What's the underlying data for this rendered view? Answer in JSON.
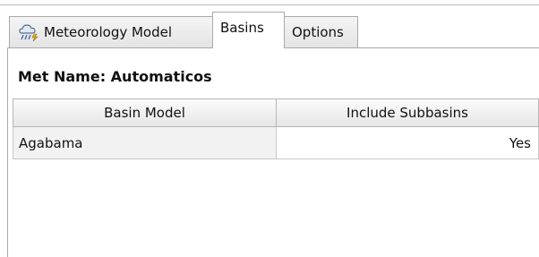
{
  "tabs": [
    {
      "label": "Meteorology Model",
      "icon": "weather-rain-icon",
      "active": false
    },
    {
      "label": "Basins",
      "active": true
    },
    {
      "label": "Options",
      "active": false
    }
  ],
  "met_name": "Met Name: Automaticos",
  "table": {
    "columns": [
      "Basin Model",
      "Include Subbasins"
    ],
    "rows": [
      {
        "basin_model": "Agabama",
        "include_subbasins": "Yes"
      }
    ]
  }
}
